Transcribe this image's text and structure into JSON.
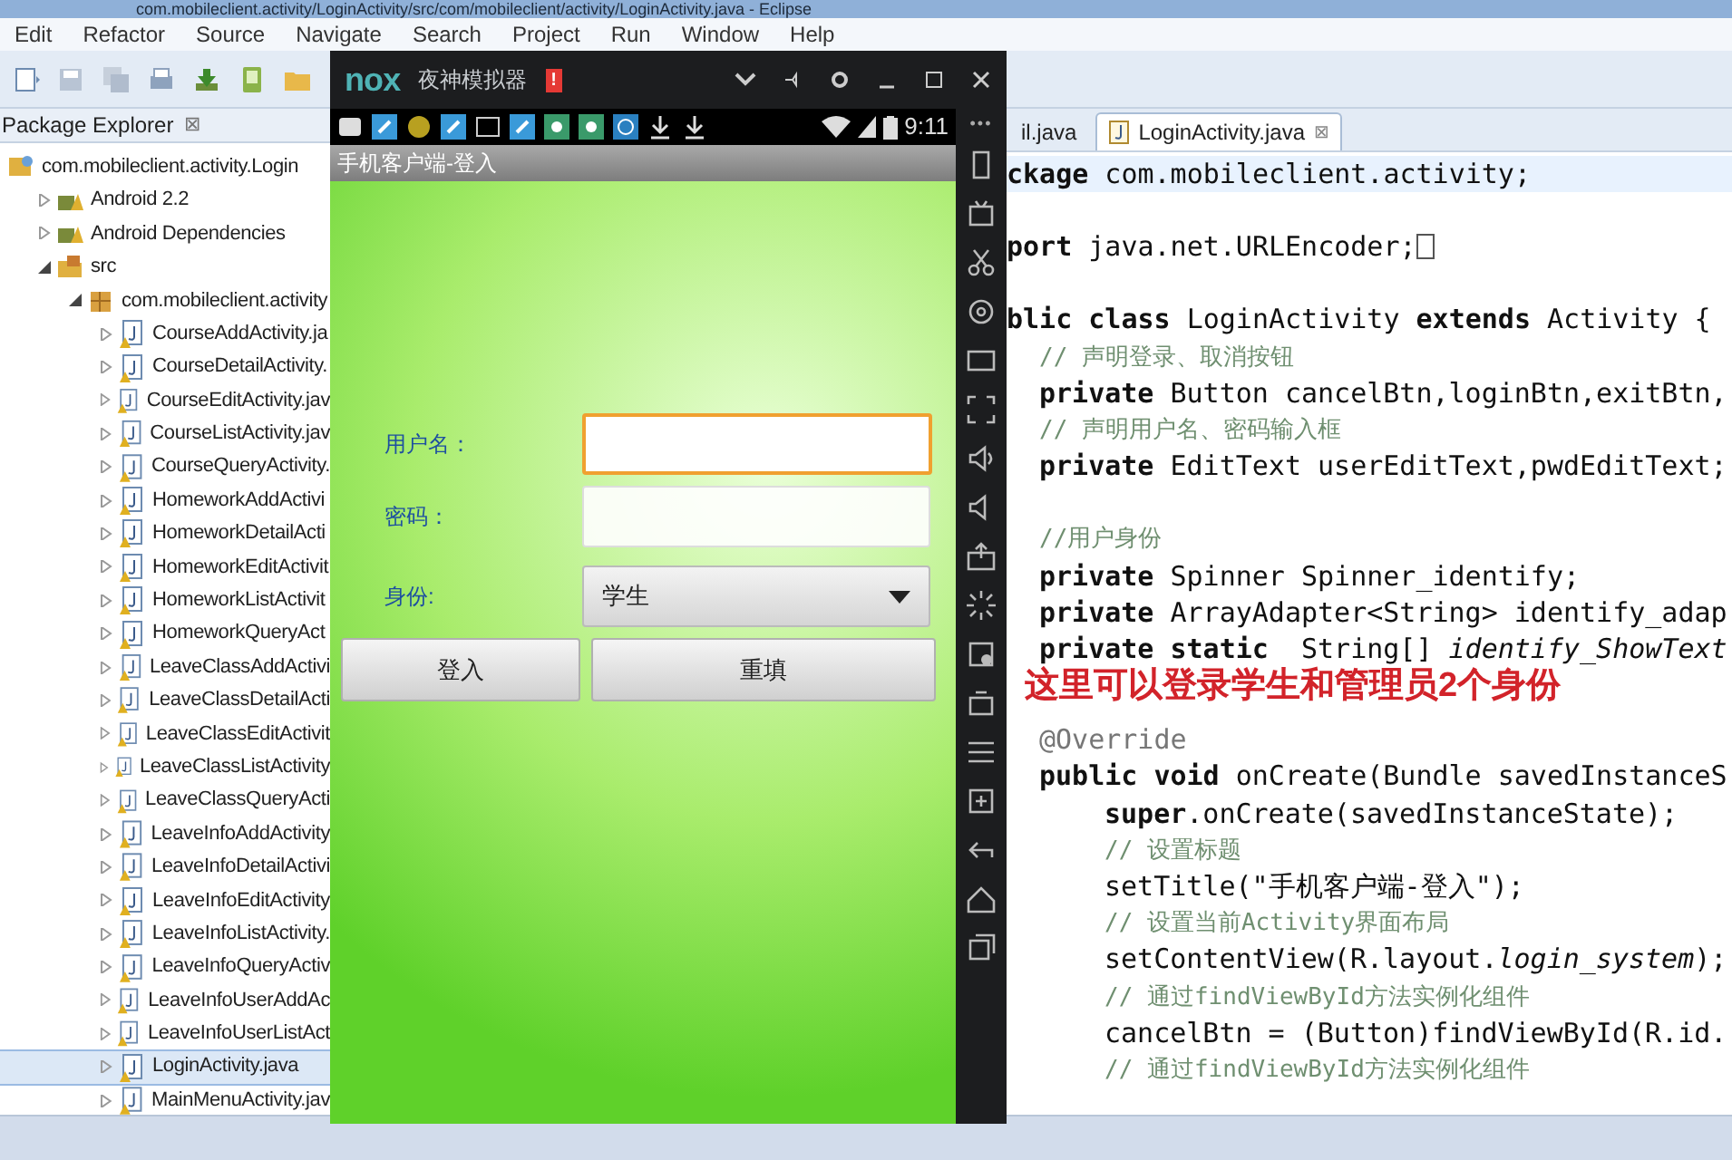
{
  "window": {
    "title": "com.mobileclient.activity/LoginActivity/src/com/mobileclient/activity/LoginActivity.java - Eclipse"
  },
  "menu": [
    "Edit",
    "Refactor",
    "Source",
    "Navigate",
    "Search",
    "Project",
    "Run",
    "Window",
    "Help"
  ],
  "package_explorer": {
    "title": "Package Explorer",
    "close": "⊠",
    "tree": [
      {
        "label": "com.mobileclient.activity.Login",
        "kind": "project",
        "children": [
          {
            "label": "Android 2.2",
            "kind": "library",
            "expanded": false
          },
          {
            "label": "Android Dependencies",
            "kind": "library",
            "expanded": false
          },
          {
            "label": "src",
            "kind": "folder",
            "expanded": true,
            "children": [
              {
                "label": "com.mobileclient.activity",
                "kind": "package",
                "expanded": true,
                "children": [
                  {
                    "label": "CourseAddActivity.ja",
                    "kind": "java",
                    "expanded": false,
                    "selected": false
                  },
                  {
                    "label": "CourseDetailActivity.",
                    "kind": "java",
                    "expanded": false,
                    "selected": false
                  },
                  {
                    "label": "CourseEditActivity.jav",
                    "kind": "java",
                    "expanded": false,
                    "selected": false
                  },
                  {
                    "label": "CourseListActivity.jav",
                    "kind": "java",
                    "expanded": false,
                    "selected": false
                  },
                  {
                    "label": "CourseQueryActivity.",
                    "kind": "java",
                    "expanded": false,
                    "selected": false
                  },
                  {
                    "label": "HomeworkAddActivi",
                    "kind": "java",
                    "expanded": false,
                    "selected": false
                  },
                  {
                    "label": "HomeworkDetailActi",
                    "kind": "java",
                    "expanded": false,
                    "selected": false
                  },
                  {
                    "label": "HomeworkEditActivit",
                    "kind": "java",
                    "expanded": false,
                    "selected": false
                  },
                  {
                    "label": "HomeworkListActivit",
                    "kind": "java",
                    "expanded": false,
                    "selected": false
                  },
                  {
                    "label": "HomeworkQueryAct",
                    "kind": "java",
                    "expanded": false,
                    "selected": false
                  },
                  {
                    "label": "LeaveClassAddActivi",
                    "kind": "java",
                    "expanded": false,
                    "selected": false
                  },
                  {
                    "label": "LeaveClassDetailActi",
                    "kind": "java",
                    "expanded": false,
                    "selected": false
                  },
                  {
                    "label": "LeaveClassEditActivit",
                    "kind": "java",
                    "expanded": false,
                    "selected": false
                  },
                  {
                    "label": "LeaveClassListActivity",
                    "kind": "java",
                    "expanded": false,
                    "selected": false
                  },
                  {
                    "label": "LeaveClassQueryActi",
                    "kind": "java",
                    "expanded": false,
                    "selected": false
                  },
                  {
                    "label": "LeaveInfoAddActivity",
                    "kind": "java",
                    "expanded": false,
                    "selected": false
                  },
                  {
                    "label": "LeaveInfoDetailActivi",
                    "kind": "java",
                    "expanded": false,
                    "selected": false
                  },
                  {
                    "label": "LeaveInfoEditActivity",
                    "kind": "java",
                    "expanded": false,
                    "selected": false
                  },
                  {
                    "label": "LeaveInfoListActivity.",
                    "kind": "java",
                    "expanded": false,
                    "selected": false
                  },
                  {
                    "label": "LeaveInfoQueryActiv",
                    "kind": "java",
                    "expanded": false,
                    "selected": false
                  },
                  {
                    "label": "LeaveInfoUserAddAc",
                    "kind": "java",
                    "expanded": false,
                    "selected": false
                  },
                  {
                    "label": "LeaveInfoUserListAct",
                    "kind": "java",
                    "expanded": false,
                    "selected": false
                  },
                  {
                    "label": "LoginActivity.java",
                    "kind": "java",
                    "expanded": false,
                    "selected": true
                  },
                  {
                    "label": "MainMenuActivity.jav",
                    "kind": "java",
                    "expanded": false,
                    "selected": false
                  }
                ]
              }
            ]
          }
        ]
      }
    ]
  },
  "emulator": {
    "logo": "nox",
    "title": "夜神模拟器",
    "alert": "!",
    "clock": "9:11",
    "app_title": "手机客户端-登入",
    "form": {
      "username_label": "用户名：",
      "password_label": "密码：",
      "role_label": "身份:",
      "role_value": "学生",
      "buttons": [
        "登入",
        "重填"
      ]
    },
    "toolbar_more": "•••"
  },
  "editor": {
    "tabs": [
      {
        "label": "il.java",
        "selected": false
      },
      {
        "label": "LoginActivity.java",
        "selected": true,
        "close": "⊠"
      }
    ],
    "lines": [
      {
        "text": "**ckage** com.mobileclient.activity;",
        "kind": "top",
        "highlighted": true
      },
      {
        "kind": "blank",
        "highlighted": false
      },
      {
        "text": "**port** java.net.URLEncoder;",
        "kind": "folded",
        "highlighted": false
      },
      {
        "kind": "blank",
        "highlighted": false
      },
      {
        "text": "**blic class** LoginActivity **extends** Activity {",
        "kind": "top",
        "highlighted": false
      },
      {
        "text": "// 声明登录、取消按钮",
        "kind": "member-comment",
        "highlighted": false
      },
      {
        "text": "**private** Button cancelBtn,loginBtn,exitBtn,",
        "kind": "member",
        "highlighted": false
      },
      {
        "text": "// 声明用户名、密码输入框",
        "kind": "member-comment",
        "highlighted": false
      },
      {
        "text": "**private** EditText userEditText,pwdEditText;",
        "kind": "member",
        "highlighted": false
      },
      {
        "kind": "blank",
        "highlighted": false
      },
      {
        "text": "//用户身份",
        "kind": "member-comment",
        "highlighted": false
      },
      {
        "text": "**private** Spinner Spinner_identify;",
        "kind": "member",
        "highlighted": false
      },
      {
        "text": "**private** ArrayAdapter<String> identify_adap",
        "kind": "member",
        "highlighted": false
      },
      {
        "text": "**private static**  String[] *identify_ShowText*",
        "kind": "member",
        "highlighted": false
      },
      {
        "text": "这里可以登录学生和管理员2个身份",
        "kind": "note",
        "highlighted": false
      },
      {
        "text": "@Override",
        "kind": "annotation",
        "highlighted": false
      },
      {
        "text": "**public void** onCreate(Bundle savedInstanceS",
        "kind": "member",
        "highlighted": false
      },
      {
        "text": "**super**.onCreate(savedInstanceState);",
        "kind": "body",
        "highlighted": false
      },
      {
        "text": "// 设置标题",
        "kind": "body-comment",
        "highlighted": false
      },
      {
        "text": "setTitle(\"手机客户端-登入\");",
        "kind": "body",
        "highlighted": false
      },
      {
        "text": "// 设置当前Activity界面布局",
        "kind": "body-comment",
        "highlighted": false
      },
      {
        "text": "setContentView(R.layout.*login_system*);",
        "kind": "body",
        "highlighted": false
      },
      {
        "text": "// 通过findViewById方法实例化组件",
        "kind": "body-comment",
        "highlighted": false
      },
      {
        "text": "cancelBtn = (Button)findViewById(R.id.",
        "kind": "body",
        "highlighted": false
      },
      {
        "text": "// 通过findViewById方法实例化组件",
        "kind": "body-comment",
        "highlighted": false
      }
    ]
  }
}
